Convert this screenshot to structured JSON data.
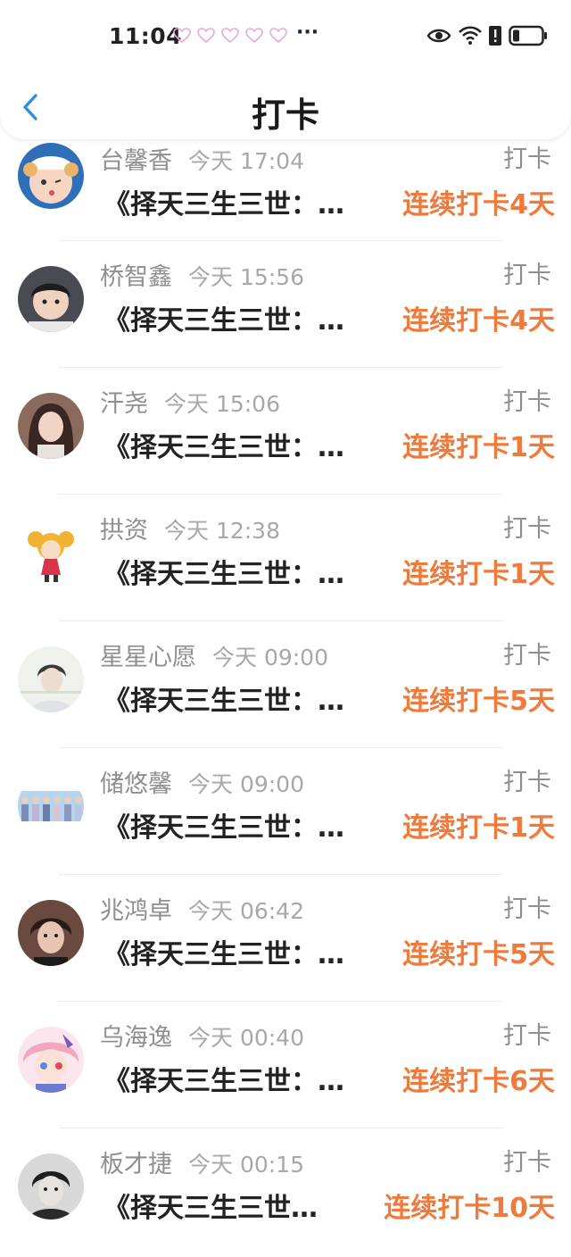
{
  "status_bar": {
    "time": "11:04",
    "dots": "···"
  },
  "header": {
    "title": "打卡",
    "back_icon": "chevron-left-icon"
  },
  "colors": {
    "accent": "#f07a3c",
    "back": "#2f8fe0",
    "name": "#8f8f8f",
    "heart": "#e8a6e0"
  },
  "entries": [
    {
      "name": "台馨香",
      "time": "今天 17:04",
      "tag": "打卡",
      "book": "《择天三生三世：…",
      "streak": "连续打卡4天"
    },
    {
      "name": "桥智鑫",
      "time": "今天 15:56",
      "tag": "打卡",
      "book": "《择天三生三世：…",
      "streak": "连续打卡4天"
    },
    {
      "name": "汗尧",
      "time": "今天 15:06",
      "tag": "打卡",
      "book": "《择天三生三世：…",
      "streak": "连续打卡1天"
    },
    {
      "name": "拱资",
      "time": "今天 12:38",
      "tag": "打卡",
      "book": "《择天三生三世：…",
      "streak": "连续打卡1天"
    },
    {
      "name": "星星心愿",
      "time": "今天 09:00",
      "tag": "打卡",
      "book": "《择天三生三世：…",
      "streak": "连续打卡5天"
    },
    {
      "name": "储悠馨",
      "time": "今天 09:00",
      "tag": "打卡",
      "book": "《择天三生三世：…",
      "streak": "连续打卡1天"
    },
    {
      "name": "兆鸿卓",
      "time": "今天 06:42",
      "tag": "打卡",
      "book": "《择天三生三世：…",
      "streak": "连续打卡5天"
    },
    {
      "name": "乌海逸",
      "time": "今天 00:40",
      "tag": "打卡",
      "book": "《择天三生三世：…",
      "streak": "连续打卡6天"
    },
    {
      "name": "板才捷",
      "time": "今天 00:15",
      "tag": "打卡",
      "book": "《择天三生三世…",
      "streak": "连续打卡10天"
    }
  ]
}
